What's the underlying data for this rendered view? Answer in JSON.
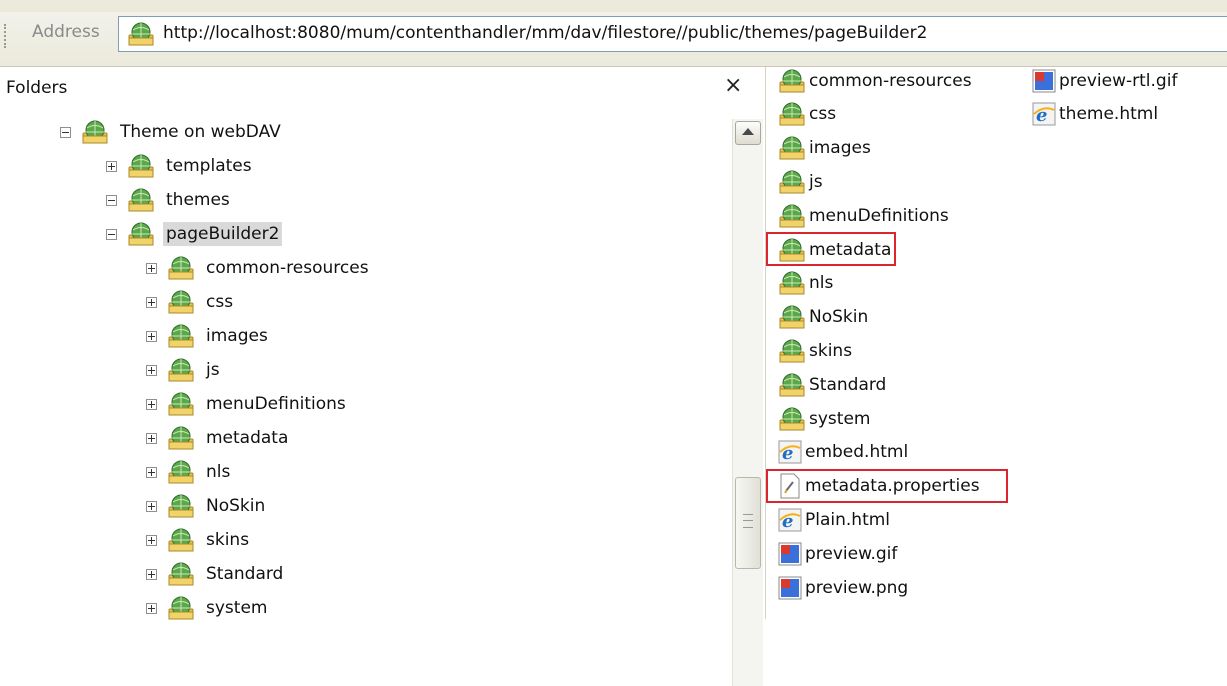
{
  "address": {
    "label": "Address",
    "url": "http://localhost:8080/mum/contenthandler/mm/dav/filestore//public/themes/pageBuilder2"
  },
  "folders_pane": {
    "title": "Folders",
    "close": "×",
    "tree": [
      {
        "label": "Theme on webDAV",
        "expander": "minus",
        "level": 0
      },
      {
        "label": "templates",
        "expander": "plus",
        "level": 1
      },
      {
        "label": "themes",
        "expander": "minus",
        "level": 1
      },
      {
        "label": "pageBuilder2",
        "expander": "minus",
        "level": 2,
        "selected": true
      },
      {
        "label": "common-resources",
        "expander": "plus",
        "level": 3
      },
      {
        "label": "css",
        "expander": "plus",
        "level": 3
      },
      {
        "label": "images",
        "expander": "plus",
        "level": 3
      },
      {
        "label": "js",
        "expander": "plus",
        "level": 3
      },
      {
        "label": "menuDefinitions",
        "expander": "plus",
        "level": 3
      },
      {
        "label": "metadata",
        "expander": "plus",
        "level": 3
      },
      {
        "label": "nls",
        "expander": "plus",
        "level": 3
      },
      {
        "label": "NoSkin",
        "expander": "plus",
        "level": 3
      },
      {
        "label": "skins",
        "expander": "plus",
        "level": 3
      },
      {
        "label": "Standard",
        "expander": "plus",
        "level": 3
      },
      {
        "label": "system",
        "expander": "plus",
        "level": 3
      }
    ]
  },
  "files": {
    "column1": [
      {
        "name": "common-resources",
        "icon": "web-folder-icon"
      },
      {
        "name": "css",
        "icon": "web-folder-icon"
      },
      {
        "name": "images",
        "icon": "web-folder-icon"
      },
      {
        "name": "js",
        "icon": "web-folder-icon"
      },
      {
        "name": "menuDefinitions",
        "icon": "web-folder-icon"
      },
      {
        "name": "metadata",
        "icon": "web-folder-icon",
        "highlighted": true
      },
      {
        "name": "nls",
        "icon": "web-folder-icon"
      },
      {
        "name": "NoSkin",
        "icon": "web-folder-icon"
      },
      {
        "name": "skins",
        "icon": "web-folder-icon"
      },
      {
        "name": "Standard",
        "icon": "web-folder-icon"
      },
      {
        "name": "system",
        "icon": "web-folder-icon"
      },
      {
        "name": "embed.html",
        "icon": "ie-html-icon"
      },
      {
        "name": "metadata.properties",
        "icon": "properties-file-icon",
        "highlighted": true
      },
      {
        "name": "Plain.html",
        "icon": "ie-html-icon"
      },
      {
        "name": "preview.gif",
        "icon": "image-file-icon"
      },
      {
        "name": "preview.png",
        "icon": "image-file-icon"
      }
    ],
    "column2": [
      {
        "name": "preview-rtl.gif",
        "icon": "image-file-icon"
      },
      {
        "name": "theme.html",
        "icon": "ie-html-icon"
      }
    ]
  },
  "colors": {
    "highlight_border": "#d9262f",
    "selected_bg": "#d9d9d9"
  }
}
